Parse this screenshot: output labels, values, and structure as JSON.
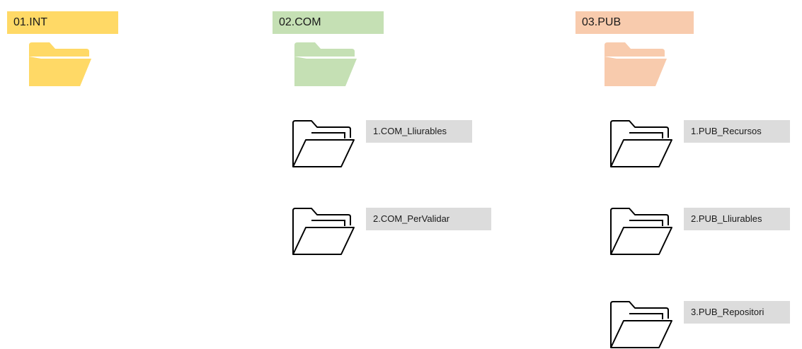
{
  "columns": [
    {
      "label": "01.INT",
      "color": "#ffd966",
      "subfolders": []
    },
    {
      "label": "02.COM",
      "color": "#c5e0b4",
      "subfolders": [
        {
          "label": "1.COM_Lliurables"
        },
        {
          "label": "2.COM_PerValidar"
        }
      ]
    },
    {
      "label": "03.PUB",
      "color": "#f8cbad",
      "subfolders": [
        {
          "label": "1.PUB_Recursos"
        },
        {
          "label": "2.PUB_Lliurables"
        },
        {
          "label": "3.PUB_Repositori"
        }
      ]
    }
  ],
  "icons": {
    "main_folder": "folder-icon",
    "sub_folder": "folder-outline-icon"
  }
}
